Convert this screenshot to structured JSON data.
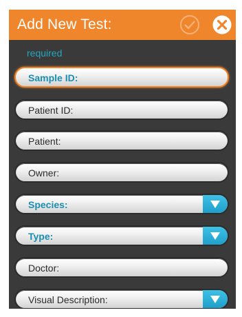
{
  "header": {
    "title": "Add New Test:",
    "accent_color": "#f0862c",
    "confirm_icon": "check-circle-icon",
    "close_icon": "close-circle-icon"
  },
  "required_label": "required",
  "fields": [
    {
      "label": "Sample ID:",
      "required": true,
      "active": true,
      "type": "text"
    },
    {
      "label": "Patient ID:",
      "required": false,
      "type": "text"
    },
    {
      "label": "Patient:",
      "required": false,
      "type": "text"
    },
    {
      "label": "Owner:",
      "required": false,
      "type": "text"
    },
    {
      "label": "Species:",
      "required": true,
      "type": "dropdown"
    },
    {
      "label": "Type:",
      "required": true,
      "type": "dropdown"
    },
    {
      "label": "Doctor:",
      "required": false,
      "type": "text"
    },
    {
      "label": "Visual Description:",
      "required": false,
      "type": "dropdown"
    }
  ],
  "colors": {
    "panel_bg": "#3a3a3a",
    "required_text": "#26a6c2",
    "dropdown_button": "#2aa9d4"
  }
}
